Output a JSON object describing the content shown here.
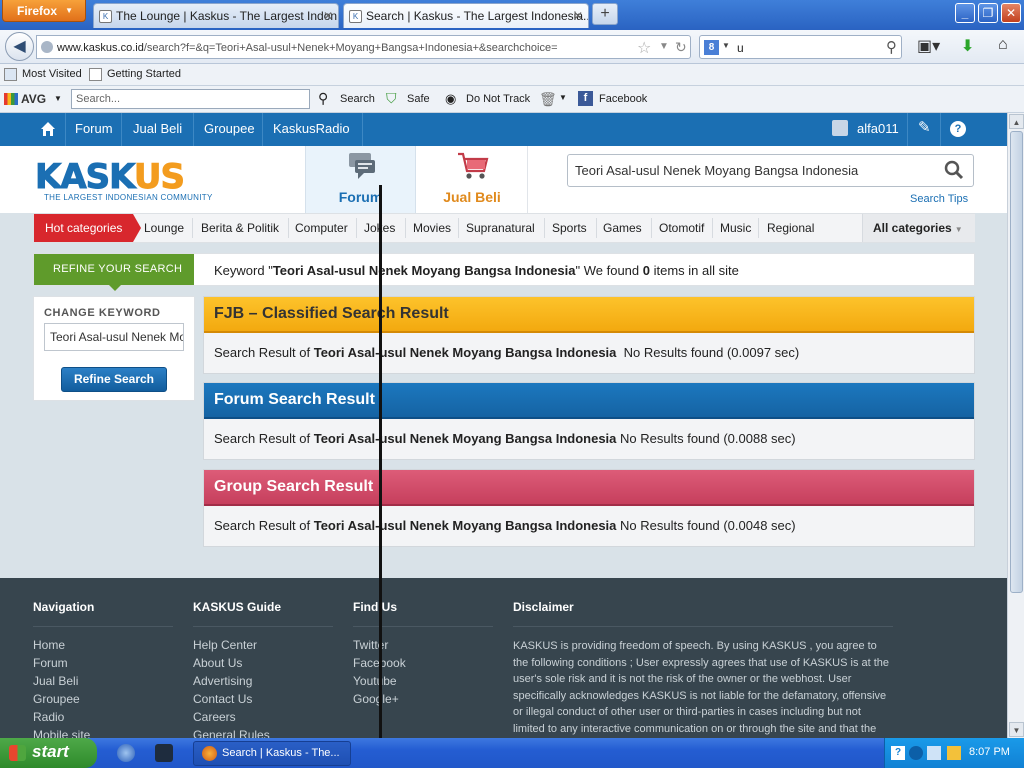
{
  "browser": {
    "menu_button": "Firefox",
    "tabs": [
      {
        "title": "The Lounge | Kaskus - The Largest Indon...",
        "active": false
      },
      {
        "title": "Search | Kaskus - The Largest Indonesia...",
        "active": true
      }
    ],
    "new_tab": "+",
    "url_host": "www.kaskus.co.id",
    "url_path": "/search?f=&q=Teori+Asal-usul+Nenek+Moyang+Bangsa+Indonesia+&searchchoice=",
    "search_engine_label": "8",
    "search_value": "u",
    "bookmarks": [
      "Most Visited",
      "Getting Started"
    ],
    "avg": {
      "logo": "AVG",
      "search_placeholder": "Search...",
      "search_button": "Search",
      "safe": "Safe",
      "do_not_track": "Do Not Track",
      "facebook": "Facebook"
    }
  },
  "kaskus": {
    "topbar": {
      "links": [
        "Forum",
        "Jual Beli",
        "Groupee",
        "KaskusRadio"
      ],
      "username": "alfa011",
      "help": "?"
    },
    "logo": {
      "text_a": "KASK",
      "text_b": "US",
      "tagline": "THE LARGEST INDONESIAN COMMUNITY"
    },
    "hubs": [
      "Forum",
      "Jual Beli"
    ],
    "search_value": "Teori Asal-usul Nenek Moyang Bangsa Indonesia",
    "search_tips": "Search Tips",
    "categories": {
      "hot": "Hot categories",
      "items": [
        "Lounge",
        "Berita & Politik",
        "Computer",
        "Jokes",
        "Movies",
        "Supranatural",
        "Sports",
        "Games",
        "Otomotif",
        "Music",
        "Regional"
      ],
      "all": "All categories"
    },
    "refine": {
      "tab_label": "REFINE YOUR SEARCH",
      "keyword_prefix": "Keyword \"",
      "keyword": "Teori Asal-usul Nenek Moyang Bangsa Indonesia",
      "found_prefix": "\" We found ",
      "found_count": "0",
      "found_suffix": " items in all site"
    },
    "change_keyword": {
      "label": "CHANGE KEYWORD",
      "value": "Teori Asal-usul Nenek Moyang Bangsa Indonesia",
      "button": "Refine Search"
    },
    "results": [
      {
        "title": "FJB – Classified Search Result",
        "prefix": "Search Result of ",
        "query": "Teori Asal-usul Nenek Moyang Bangsa Indonesia",
        "status": "  No Results found (0.0097 sec)"
      },
      {
        "title": "Forum Search Result",
        "prefix": "Search Result of ",
        "query": "Teori Asal-usul Nenek Moyang Bangsa Indonesia",
        "status": " No Results found (0.0088 sec)"
      },
      {
        "title": "Group Search Result",
        "prefix": "Search Result of ",
        "query": "Teori Asal-usul Nenek Moyang Bangsa Indonesia",
        "status": " No Results found (0.0048 sec)"
      }
    ],
    "footer": {
      "navigation": {
        "title": "Navigation",
        "items": [
          "Home",
          "Forum",
          "Jual Beli",
          "Groupee",
          "Radio",
          "Mobile site"
        ]
      },
      "guide": {
        "title": "KASKUS Guide",
        "items": [
          "Help Center",
          "About Us",
          "Advertising",
          "Contact Us",
          "Careers",
          "General Rules"
        ]
      },
      "findus": {
        "title": "Find Us",
        "items": [
          "Twitter",
          "Facebook",
          "Youtube",
          "Google+"
        ]
      },
      "disclaimer": {
        "title": "Disclaimer",
        "text": "KASKUS is providing freedom of speech. By using KASKUS , you agree to the following conditions ; User expressly agrees that use of KASKUS is at the user's sole risk and it is not the risk of the owner or the webhost. User specifically acknowledges KASKUS is not liable for the defamatory, offensive or illegal conduct of other user or third-parties in cases including but not limited to any interactive communication on or through the site and that the risk from"
      }
    }
  },
  "taskbar": {
    "start": "start",
    "task_title": "Search | Kaskus - The...",
    "clock": "8:07 PM"
  }
}
